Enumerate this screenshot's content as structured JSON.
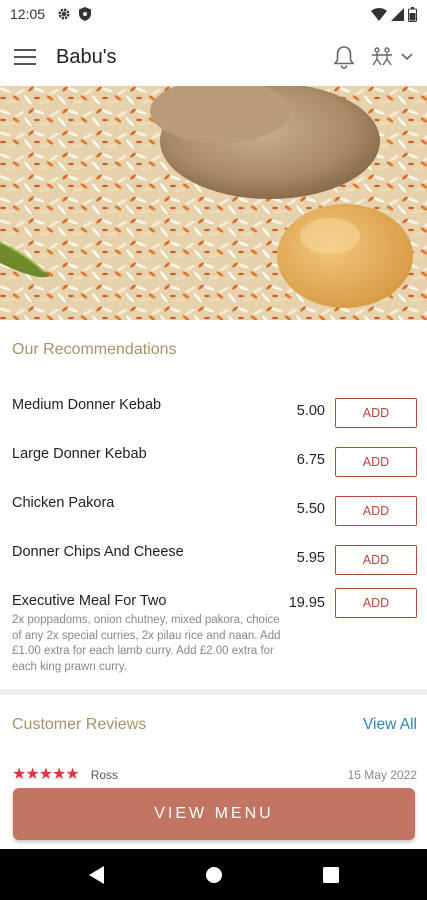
{
  "status_bar": {
    "time": "12:05",
    "icons": [
      "gear-icon",
      "shield-icon",
      "wifi-icon",
      "signal-icon",
      "battery-icon"
    ]
  },
  "app_bar": {
    "title": "Babu's",
    "icons": [
      "menu-icon",
      "bell-icon",
      "accessibility-icon",
      "chevron-down-icon"
    ]
  },
  "hero": {
    "alt": "biryani dish photo"
  },
  "recommendations": {
    "title": "Our Recommendations",
    "items": [
      {
        "name": "Medium Donner Kebab",
        "price": "5.00",
        "add_label": "ADD"
      },
      {
        "name": "Large Donner Kebab",
        "price": "6.75",
        "add_label": "ADD"
      },
      {
        "name": "Chicken Pakora",
        "price": "5.50",
        "add_label": "ADD"
      },
      {
        "name": "Donner Chips And Cheese",
        "price": "5.95",
        "add_label": "ADD"
      },
      {
        "name": "Executive Meal For Two",
        "price": "19.95",
        "add_label": "ADD",
        "description": "2x poppadoms, onion chutney, mixed pakora, choice of any 2x special curries, 2x pilau rice and naan. Add £1.00 extra for each lamb curry. Add £2.00 extra for each king prawn curry."
      }
    ]
  },
  "reviews": {
    "title": "Customer Reviews",
    "view_all_label": "View All",
    "first": {
      "stars": "★★★★★",
      "reviewer": "Ross",
      "date": "15 May 2022"
    }
  },
  "cta": {
    "label": "VIEW MENU"
  },
  "colors": {
    "accent": "#b5493a",
    "cta": "#c27562",
    "section_title": "#a8926a",
    "link": "#2e84b6"
  }
}
